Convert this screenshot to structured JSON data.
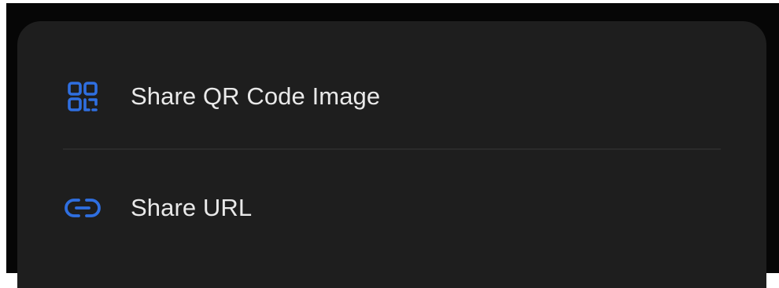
{
  "share_sheet": {
    "accent_color": "#2f6fe0",
    "items": [
      {
        "icon": "qr-code-icon",
        "label": "Share QR Code Image"
      },
      {
        "icon": "link-icon",
        "label": "Share URL"
      }
    ]
  }
}
